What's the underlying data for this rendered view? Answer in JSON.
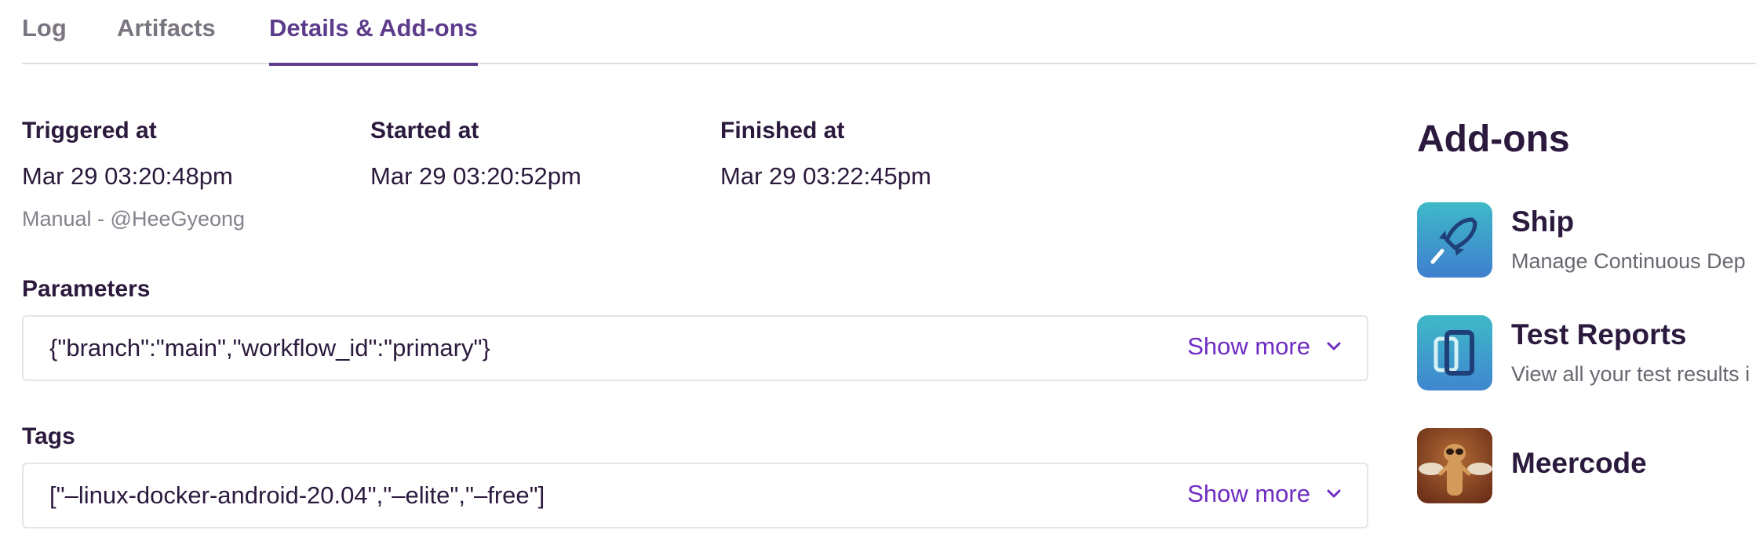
{
  "tabs": {
    "log": "Log",
    "artifacts": "Artifacts",
    "details": "Details & Add-ons"
  },
  "meta": {
    "triggered_label": "Triggered at",
    "triggered_value": "Mar 29 03:20:48pm",
    "triggered_by": "Manual - @HeeGyeong",
    "started_label": "Started at",
    "started_value": "Mar 29 03:20:52pm",
    "finished_label": "Finished at",
    "finished_value": "Mar 29 03:22:45pm"
  },
  "parameters": {
    "label": "Parameters",
    "value": "{\"branch\":\"main\",\"workflow_id\":\"primary\"}",
    "show_more": "Show more"
  },
  "tags": {
    "label": "Tags",
    "value": "[\"–linux-docker-android-20.04\",\"–elite\",\"–free\"]",
    "show_more": "Show more"
  },
  "addons": {
    "title": "Add-ons",
    "items": [
      {
        "name": "Ship",
        "description": "Manage Continuous Dep",
        "icon": "rocket-icon"
      },
      {
        "name": "Test Reports",
        "description": "View all your test results i",
        "icon": "test-reports-icon"
      },
      {
        "name": "Meercode",
        "description": "",
        "icon": "meerkat-icon"
      }
    ]
  },
  "colors": {
    "accent": "#5d3c8c",
    "link": "#6e2cc2",
    "text": "#2b1a3d",
    "muted": "#86818c"
  }
}
